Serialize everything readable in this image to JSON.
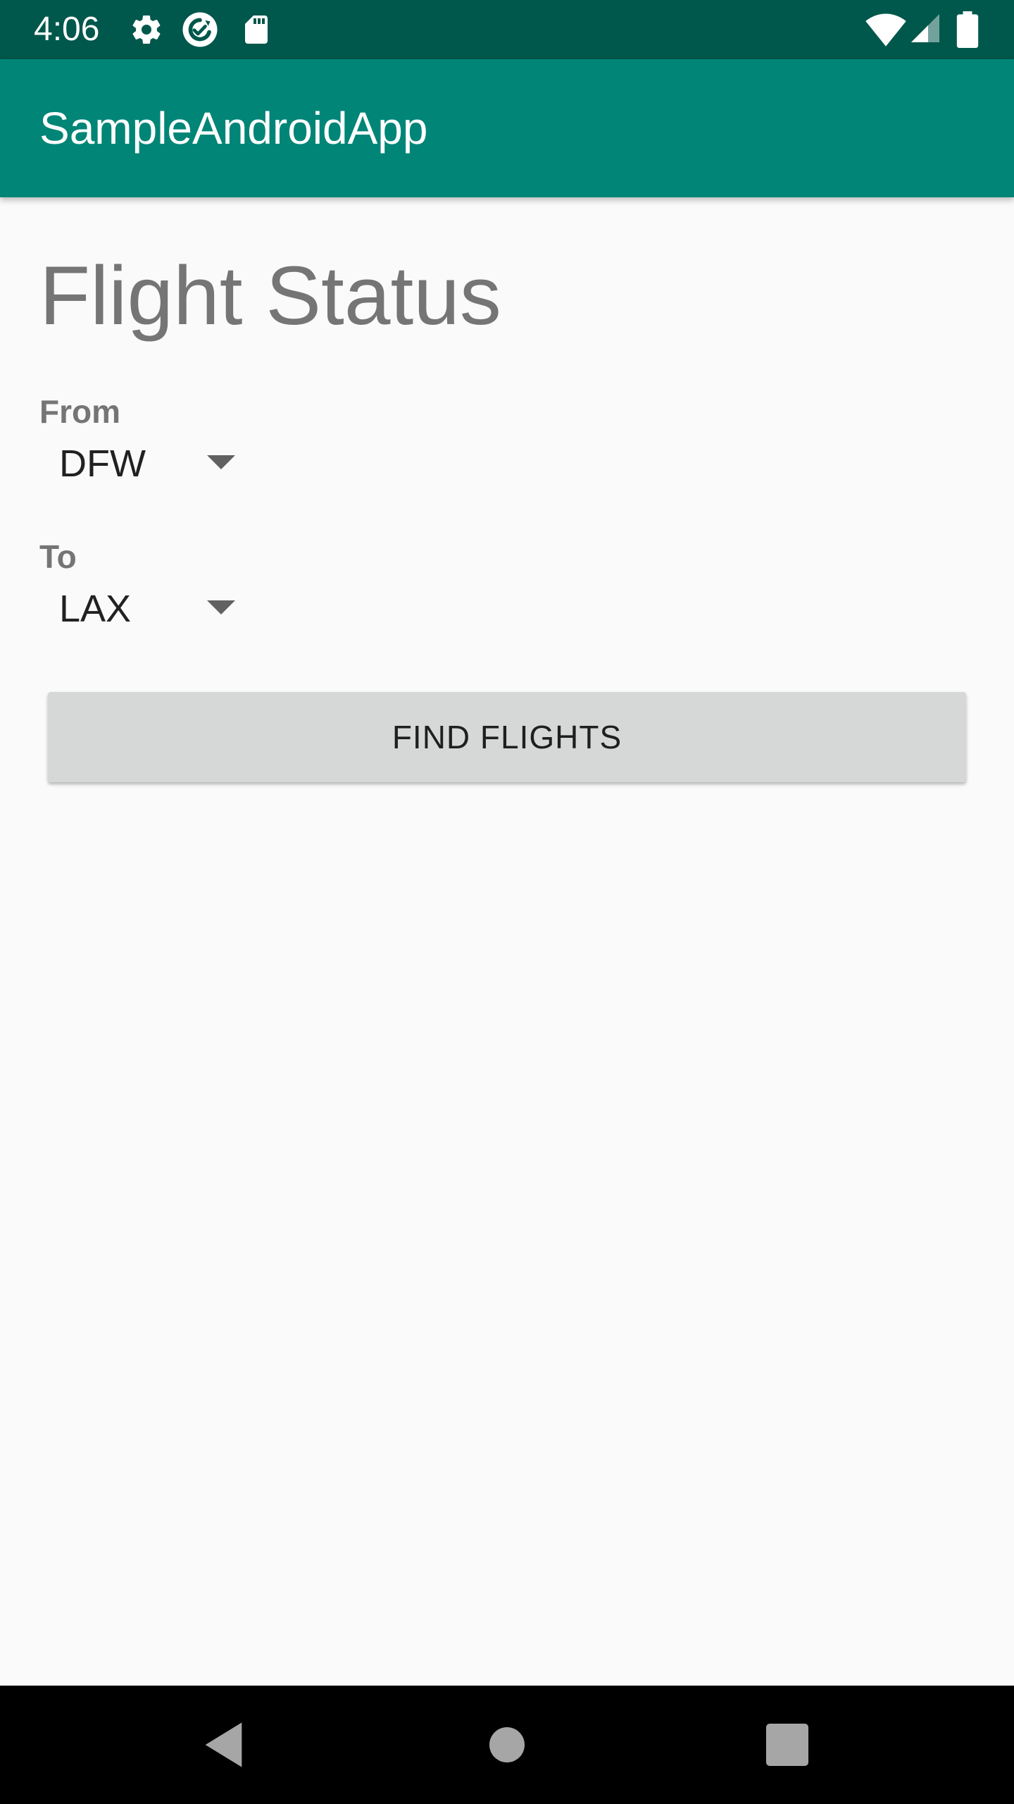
{
  "status_bar": {
    "time": "4:06",
    "icons_left": [
      "settings-gear-icon",
      "sync-icon",
      "sd-card-icon"
    ],
    "icons_right": [
      "wifi-icon",
      "cell-signal-icon",
      "battery-icon"
    ],
    "background": "#00574b"
  },
  "app_bar": {
    "title": "SampleAndroidApp",
    "background": "#008577"
  },
  "main": {
    "title": "Flight Status",
    "from": {
      "label": "From",
      "selected": "DFW"
    },
    "to": {
      "label": "To",
      "selected": "LAX"
    },
    "find_button": "FIND FLIGHTS"
  },
  "nav_bar": {
    "buttons": [
      "back-icon",
      "home-icon",
      "recents-icon"
    ]
  }
}
